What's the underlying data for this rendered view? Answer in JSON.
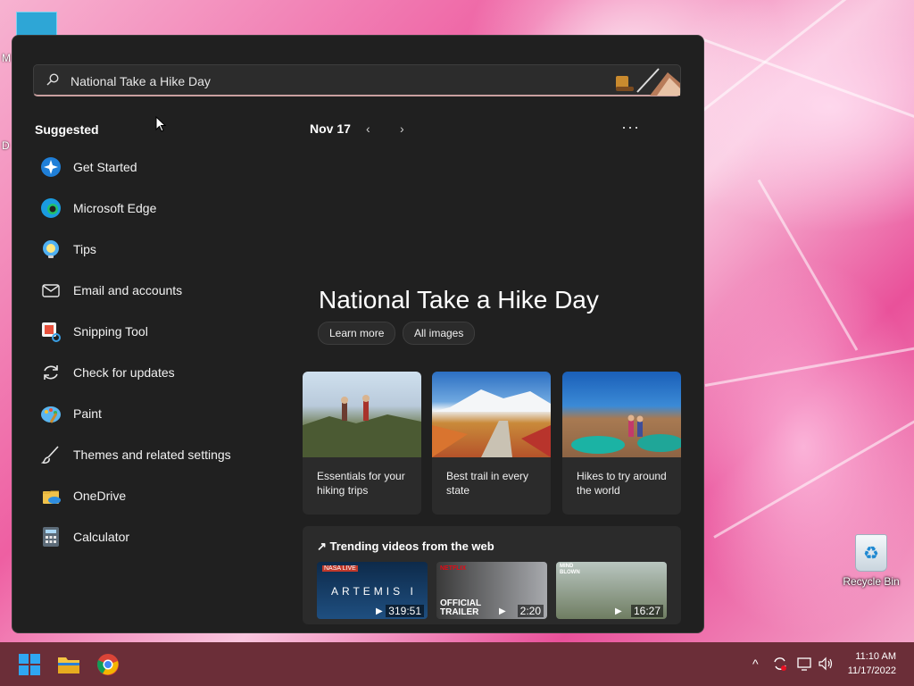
{
  "desktop": {
    "left_label_top": "M",
    "left_label_mid": "D",
    "recycle_bin_label": "Recycle Bin"
  },
  "search": {
    "value": "National Take a Hike Day"
  },
  "suggested": {
    "title": "Suggested",
    "items": [
      {
        "label": "Get Started",
        "icon": "get-started-icon"
      },
      {
        "label": "Microsoft Edge",
        "icon": "edge-icon"
      },
      {
        "label": "Tips",
        "icon": "tips-icon"
      },
      {
        "label": "Email and accounts",
        "icon": "mail-icon"
      },
      {
        "label": "Snipping Tool",
        "icon": "snipping-tool-icon"
      },
      {
        "label": "Check for updates",
        "icon": "refresh-icon"
      },
      {
        "label": "Paint",
        "icon": "paint-icon"
      },
      {
        "label": "Themes and related settings",
        "icon": "brush-icon"
      },
      {
        "label": "OneDrive",
        "icon": "onedrive-icon"
      },
      {
        "label": "Calculator",
        "icon": "calculator-icon"
      }
    ]
  },
  "feed": {
    "date": "Nov 17",
    "prev": "‹",
    "next": "›",
    "more": "···",
    "title": "National Take a Hike Day",
    "learn_more": "Learn more",
    "all_images": "All images",
    "cards": [
      {
        "caption": "Essentials for your hiking trips"
      },
      {
        "caption": "Best trail in every state"
      },
      {
        "caption": "Hikes to try around the world"
      }
    ],
    "trending": {
      "title": "Trending videos from the web",
      "videos": [
        {
          "badge": "NASA LIVE",
          "overlay": "ARTEMIS I",
          "duration": "319:51"
        },
        {
          "badge": "NETFLIX",
          "overlay": "OFFICIAL TRAILER",
          "duration": "2:20"
        },
        {
          "badge": "MIND BLOWN",
          "overlay": "",
          "duration": "16:27"
        }
      ]
    }
  },
  "taskbar": {
    "time": "11:10 AM",
    "date": "11/17/2022",
    "tray_chevron": "^"
  },
  "colors": {
    "accent_taskbar": "#6b2e38",
    "panel": "#202020"
  }
}
